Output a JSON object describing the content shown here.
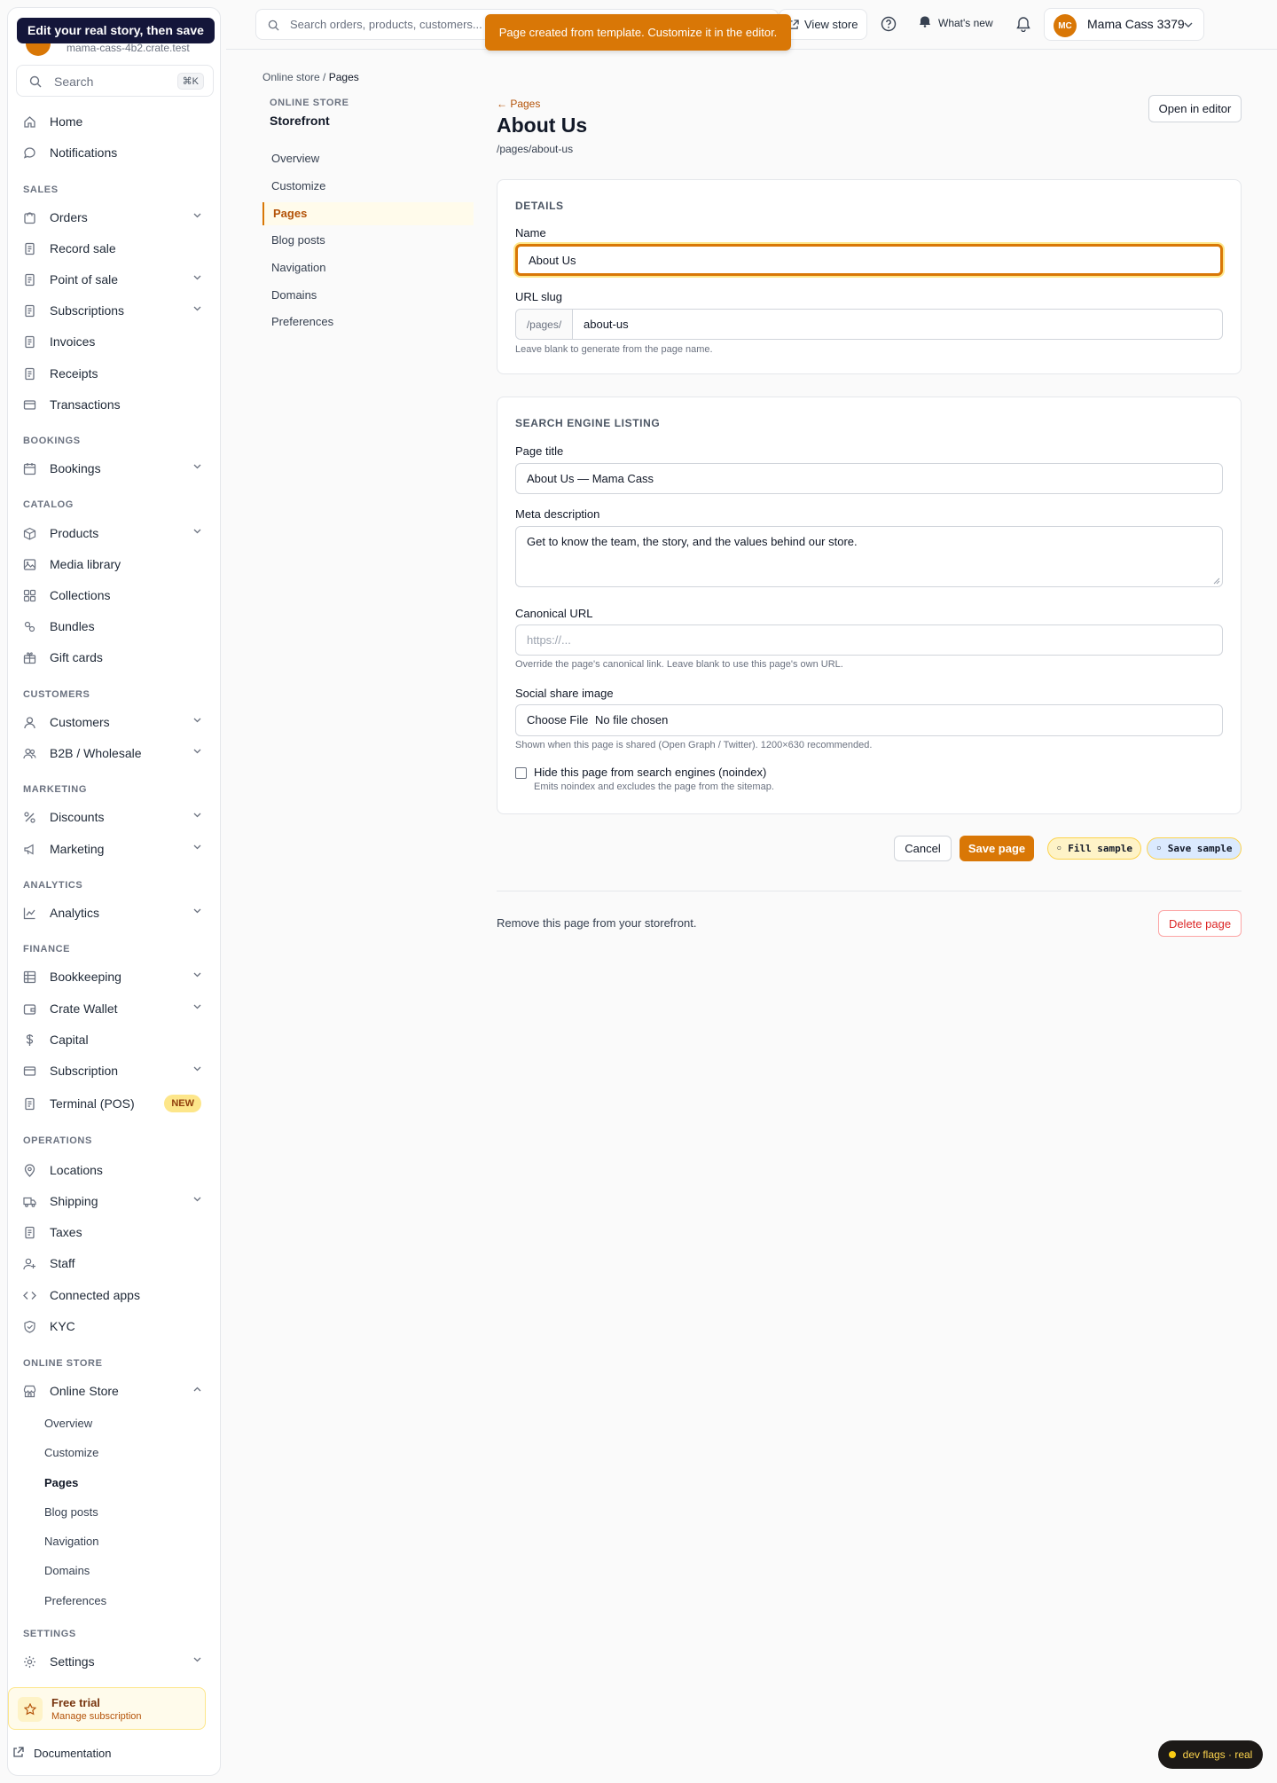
{
  "tooltip": "Edit your real story, then save",
  "account": {
    "email": "mama-cass-4b2.crate.test",
    "name": "Mama Cass 3379",
    "initials": "MC"
  },
  "sidebar": {
    "search_placeholder": "Search",
    "search_kbd": "⌘K",
    "items": {
      "home": "Home",
      "notifications": "Notifications",
      "orders": "Orders",
      "record_sale": "Record sale",
      "pos": "Point of sale",
      "subscriptions": "Subscriptions",
      "invoices": "Invoices",
      "receipts": "Receipts",
      "transactions": "Transactions",
      "bookings": "Bookings",
      "products": "Products",
      "media": "Media library",
      "collections": "Collections",
      "bundles": "Bundles",
      "gift_cards": "Gift cards",
      "customers": "Customers",
      "b2b": "B2B / Wholesale",
      "discounts": "Discounts",
      "marketing": "Marketing",
      "analytics": "Analytics",
      "bookkeeping": "Bookkeeping",
      "crate_wallet": "Crate Wallet",
      "capital": "Capital",
      "subscription": "Subscription",
      "terminal": "Terminal (POS)",
      "locations": "Locations",
      "shipping": "Shipping",
      "taxes": "Taxes",
      "staff": "Staff",
      "connected_apps": "Connected apps",
      "kyc": "KYC",
      "online_store": "Online Store",
      "settings": "Settings"
    },
    "sections": {
      "sales": "SALES",
      "bookings": "BOOKINGS",
      "catalog": "CATALOG",
      "customers": "CUSTOMERS",
      "marketing": "MARKETING",
      "analytics": "ANALYTICS",
      "finance": "FINANCE",
      "operations": "OPERATIONS",
      "online_store": "ONLINE STORE",
      "settings": "SETTINGS"
    },
    "terminal_badge": "NEW",
    "online_store_sub": [
      "Overview",
      "Customize",
      "Pages",
      "Blog posts",
      "Navigation",
      "Domains",
      "Preferences"
    ],
    "trial": {
      "title": "Free trial",
      "subtitle": "Manage subscription"
    },
    "documentation": "Documentation"
  },
  "topbar": {
    "search_placeholder": "Search orders, products, customers...",
    "toast": "Page created from template. Customize it in the editor.",
    "view_store": "View store",
    "whats_new": "What's new"
  },
  "breadcrumb": {
    "parent": "Online store",
    "separator": "/",
    "current": "Pages"
  },
  "local_nav": {
    "kicker": "ONLINE STORE",
    "title": "Storefront",
    "items": [
      "Overview",
      "Customize",
      "Pages",
      "Blog posts",
      "Navigation",
      "Domains",
      "Preferences"
    ]
  },
  "page": {
    "back": "← Pages",
    "title": "About Us",
    "path": "/pages/about-us",
    "open_editor": "Open in editor",
    "details": {
      "heading": "DETAILS",
      "name_label": "Name",
      "name_value": "About Us",
      "slug_label": "URL slug",
      "slug_prefix": "/pages/",
      "slug_value": "about-us",
      "slug_hint": "Leave blank to generate from the page name."
    },
    "seo": {
      "heading": "SEARCH ENGINE LISTING",
      "title_label": "Page title",
      "title_value": "About Us — Mama Cass",
      "meta_label": "Meta description",
      "meta_value": "Get to know the team, the story, and the values behind our store.",
      "canonical_label": "Canonical URL",
      "canonical_placeholder": "https://...",
      "canonical_hint": "Override the page's canonical link. Leave blank to use this page's own URL.",
      "share_label": "Social share image",
      "share_button": "Choose File",
      "share_value": "No file chosen",
      "share_hint": "Shown when this page is shared (Open Graph / Twitter). 1200×630 recommended.",
      "noindex_label": "Hide this page from search engines (noindex)",
      "noindex_hint": "Emits noindex and excludes the page from the sitemap.",
      "noindex_checked": false
    },
    "actions": {
      "cancel": "Cancel",
      "save": "Save page",
      "fill_sample": "◦ Fill sample",
      "save_sample": "◦ Save sample"
    },
    "danger": {
      "text": "Remove this page from your storefront.",
      "delete": "Delete page"
    }
  },
  "dev_flags": "dev flags · real",
  "colors": {
    "accent": "#d97706",
    "danger": "#dc2626",
    "navy": "#14163a"
  }
}
